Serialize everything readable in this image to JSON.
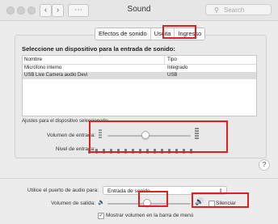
{
  "window": {
    "title": "Sound"
  },
  "search": {
    "placeholder": "Search"
  },
  "tabs": [
    {
      "label": "Efectos de sonido"
    },
    {
      "label": "Uscita"
    },
    {
      "label": "Ingresso"
    }
  ],
  "input": {
    "heading": "Seleccione un dispositivo para la entrada de sonido:",
    "columns": {
      "name": "Nombre",
      "type": "Tipo"
    },
    "devices": [
      {
        "name": "Micrófono interno",
        "type": "Integrado"
      },
      {
        "name": "USB Live Camera audio Devi",
        "type": "USB",
        "selected": true
      }
    ],
    "settings_label": "Ajustes para el dispositivo seleccionado:",
    "volume_label": "Volumen de entrada:",
    "volume_value": 0.45,
    "level_label": "Nivel de entrada:",
    "level_segments": 15
  },
  "output": {
    "port_label": "Utilice el puerto de audio para:",
    "port_value": "Entrada de sonido",
    "volume_label": "Volumen de salida:",
    "volume_value": 0.47,
    "mute_label": "Silenciar",
    "show_menu_label": "Mostrar volumen en la barra de menú",
    "show_menu_checked": true
  }
}
